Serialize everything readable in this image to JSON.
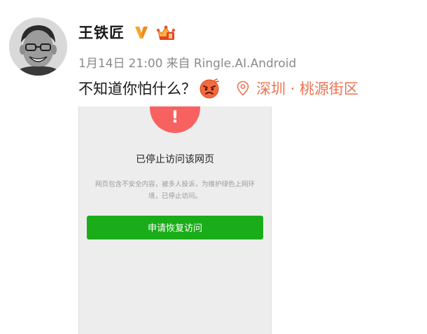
{
  "post": {
    "author": "王铁匠",
    "meta": {
      "date": "1月14日",
      "time": "21:00",
      "source": "来自 Ringle.AI.Android"
    },
    "text": "不知道你怕什么？",
    "location": "深圳 · 桃源街区"
  },
  "icons": {
    "avatar": "avatar-photo",
    "verified": "verified-v-icon",
    "vip": "vip-crown-icon",
    "emoji": "angry-face-emoji-icon",
    "location": "location-pin-icon",
    "warning": "exclamation-icon"
  },
  "screenshot": {
    "warning_mark": "!",
    "title": "已停止访问该网页",
    "description": "网页包含不安全内容，被多人投诉，为维护绿色上网环境，已停止访问。",
    "button_label": "申请恢复访问"
  },
  "colors": {
    "location": "#eb7350",
    "warning": "#f76260",
    "button": "#1aad19",
    "verified": "#f5a623",
    "meta_text": "#8a8a8a"
  }
}
